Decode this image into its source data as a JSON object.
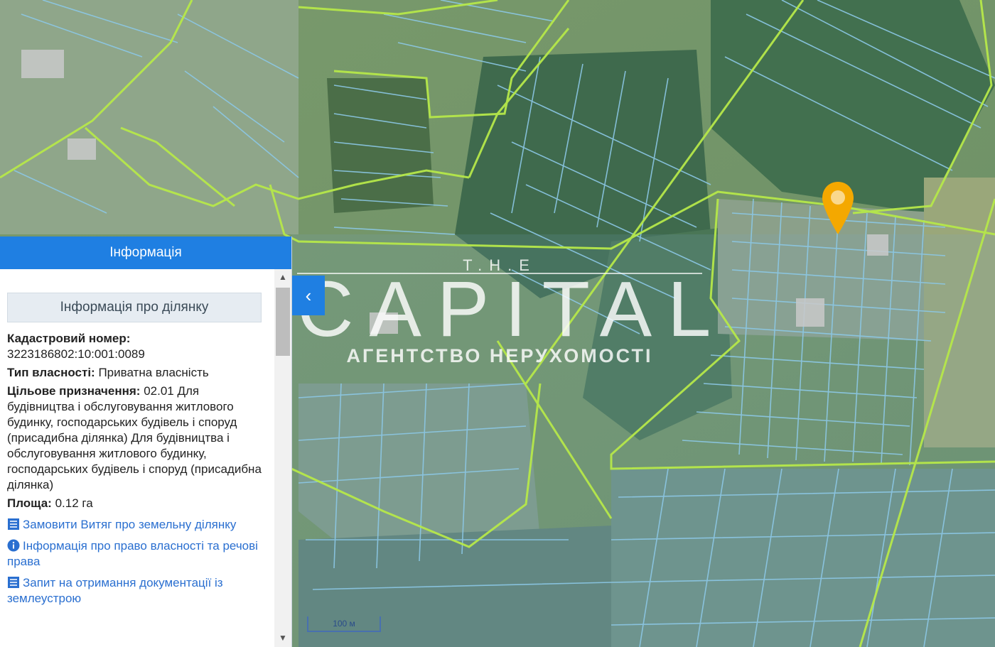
{
  "colors": {
    "panel_header": "#1f7fe2",
    "link": "#2a6fd0",
    "parcel_line": "#8cc8e6",
    "boundary_line": "#b6e84a",
    "pin": "#f4a800"
  },
  "panel": {
    "header_title": "Інформація",
    "section_title": "Інформація про ділянку",
    "cadastral_label": "Кадастровий номер:",
    "cadastral_value": "3223186802:10:001:0089",
    "ownership_label": "Тип власності:",
    "ownership_value": "Приватна власність",
    "purpose_label": "Цільове призначення:",
    "purpose_value": "02.01 Для будівництва і обслуговування житлового будинку, господарських будівель і споруд (присадибна ділянка) Для будівництва і обслуговування житлового будинку, господарських будівель і споруд (присадибна ділянка)",
    "area_label": "Площа:",
    "area_value": "0.12 га",
    "links": [
      {
        "icon": "list-icon",
        "text": "Замовити Витяг про земельну ділянку"
      },
      {
        "icon": "info-icon",
        "text": "Інформація про право власності та речові права"
      },
      {
        "icon": "list-icon",
        "text": "Запит на отримання документації із землеустрою"
      }
    ],
    "scroll_up_icon": "▲",
    "scroll_down_icon": "▼"
  },
  "collapse_icon": "‹",
  "watermark": {
    "top": "T.H.E",
    "main": "CAPITAL",
    "sub": "АГЕНТСТВО НЕРУХОМОСТІ"
  },
  "scale_label": "100 м"
}
